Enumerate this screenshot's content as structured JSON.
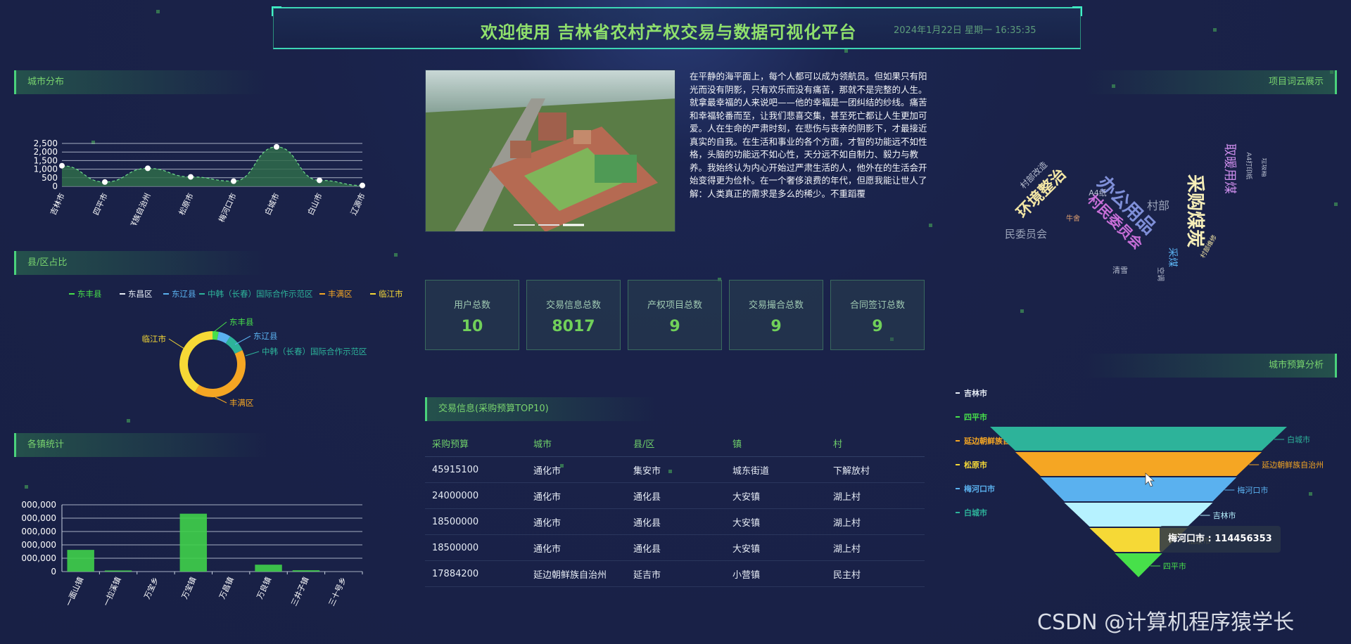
{
  "header": {
    "title": "欢迎使用 吉林省农村产权交易与数据可视化平台",
    "datetime": "2024年1月22日 星期一 16:35:35"
  },
  "panels": {
    "city_distribution": "城市分布",
    "county_share": "县/区占比",
    "town_stats": "各镇统计",
    "word_cloud": "项目词云展示",
    "city_budget": "城市预算分析",
    "trade_info": "交易信息(采购预算TOP10)"
  },
  "article": "在平静的海平面上，每个人都可以成为领航员。但如果只有阳光而没有阴影，只有欢乐而没有痛苦，那就不是完整的人生。就拿最幸福的人来说吧——他的幸福是一团纠结的纱线。痛苦和幸福轮番而至，让我们悲喜交集，甚至死亡都让人生更加可爱。人在生命的严肃时刻，在悲伤与丧亲的阴影下，才最接近真实的自我。在生活和事业的各个方面，才智的功能远不如性格，头脑的功能远不如心性，天分远不如自制力、毅力与教养。我始终认为内心开始过严肃生活的人，他外在的生活会开始变得更为俭朴。在一个奢侈浪费的年代，但愿我能让世人了解：人类真正的需求是多么的稀少。不重蹈覆",
  "stats": [
    {
      "label": "用户总数",
      "value": "10"
    },
    {
      "label": "交易信息总数",
      "value": "8017"
    },
    {
      "label": "产权项目总数",
      "value": "9"
    },
    {
      "label": "交易撮合总数",
      "value": "9"
    },
    {
      "label": "合同签订总数",
      "value": "9"
    }
  ],
  "table": {
    "headers": [
      "采购预算",
      "城市",
      "县/区",
      "镇",
      "村"
    ],
    "rows": [
      [
        "45915100",
        "通化市",
        "集安市",
        "城东街道",
        "下解放村"
      ],
      [
        "24000000",
        "通化市",
        "通化县",
        "大安镇",
        "湖上村"
      ],
      [
        "18500000",
        "通化市",
        "通化县",
        "大安镇",
        "湖上村"
      ],
      [
        "18500000",
        "通化市",
        "通化县",
        "大安镇",
        "湖上村"
      ],
      [
        "17884200",
        "延边朝鲜族自治州",
        "延吉市",
        "小营镇",
        "民主村"
      ]
    ]
  },
  "tooltip": "梅河口市 : 114456353",
  "watermark": "CSDN @计算机程序猿学长",
  "colors": {
    "accent_green": "#71d05a",
    "title_green": "#8fe06c",
    "area_fill": "#2f6b4a",
    "funnel": [
      "#2db39a",
      "#f5a623",
      "#5ab1ef",
      "#b6f2ff",
      "#f6d936",
      "#47e04a"
    ]
  },
  "word_cloud": [
    {
      "text": "采购煤炭",
      "color": "#f6eeb8",
      "size": 26,
      "rotate": 90
    },
    {
      "text": "办公用品",
      "color": "#7f8fd8",
      "size": 26,
      "rotate": 45
    },
    {
      "text": "环境整治",
      "color": "#f3e6a4",
      "size": 22,
      "rotate": -45
    },
    {
      "text": "村民委员会",
      "color": "#c86fd8",
      "size": 20,
      "rotate": 45
    },
    {
      "text": "取暖用煤",
      "color": "#c98be8",
      "size": 18,
      "rotate": 90
    },
    {
      "text": "村部",
      "color": "#9aa3b8",
      "size": 16,
      "rotate": 0
    },
    {
      "text": "民委员会",
      "color": "#9aa3b8",
      "size": 15,
      "rotate": 0
    },
    {
      "text": "采煤",
      "color": "#5ab1ef",
      "size": 14,
      "rotate": 90
    },
    {
      "text": "村部改造",
      "color": "#b8bfd0",
      "size": 12,
      "rotate": -45
    },
    {
      "text": "A4纸",
      "color": "#b8bfd0",
      "size": 11,
      "rotate": 0
    },
    {
      "text": "牛舍",
      "color": "#e0a070",
      "size": 10,
      "rotate": 0
    },
    {
      "text": "清雪",
      "color": "#b8bfd0",
      "size": 11,
      "rotate": 0
    },
    {
      "text": "空调",
      "color": "#b8bfd0",
      "size": 10,
      "rotate": 90
    },
    {
      "text": "村部维修",
      "color": "#f3e6a4",
      "size": 9,
      "rotate": -60
    },
    {
      "text": "A4打印纸",
      "color": "#b8bfd0",
      "size": 9,
      "rotate": 90
    },
    {
      "text": "垃圾箱",
      "color": "#b8bfd0",
      "size": 9,
      "rotate": 90
    }
  ],
  "chart_data": [
    {
      "type": "area",
      "title": "城市分布",
      "categories": [
        "吉林市",
        "四平市",
        "延边朝鲜族自治州",
        "松原市",
        "梅河口市",
        "白城市",
        "白山市",
        "辽源市"
      ],
      "values": [
        1200,
        250,
        1050,
        550,
        300,
        2300,
        350,
        50
      ],
      "ylim": [
        0,
        2500
      ],
      "yticks": [
        "2,500",
        "2,000",
        "1,500",
        "1,000",
        "500",
        "0"
      ]
    },
    {
      "type": "pie",
      "title": "县/区占比",
      "legend": [
        "东丰县",
        "东昌区",
        "东辽县",
        "中韩（长春）国际合作示范区",
        "丰满区",
        "临江市"
      ],
      "legend_colors": [
        "#47e04a",
        "#e6ecf5",
        "#5ab1ef",
        "#2db39a",
        "#f5a623",
        "#f6d936"
      ],
      "labels": [
        "东丰县",
        "东辽县",
        "中韩（长春）国际合作示范区",
        "丰满区",
        "临江市"
      ],
      "values": [
        3,
        6,
        9,
        41,
        41
      ]
    },
    {
      "type": "bar",
      "title": "各镇统计",
      "categories": [
        "一面山镇",
        "一拉溪镇",
        "万宝乡",
        "万宝镇",
        "万昌镇",
        "万良镇",
        "三井子镇",
        "三十号乡"
      ],
      "values": [
        1950000,
        100000,
        0,
        5200000,
        0,
        620000,
        120000,
        0
      ],
      "yticks": [
        "000,000",
        "000,000",
        "000,000",
        "000,000",
        "000,000",
        "0"
      ],
      "ylim": [
        0,
        6000000
      ]
    },
    {
      "type": "funnel",
      "title": "城市预算分析",
      "legend": [
        "吉林市",
        "四平市",
        "延边朝鲜族自治州",
        "松原市",
        "梅河口市",
        "白城市"
      ],
      "legend_colors": [
        "#e6ecf5",
        "#47e04a",
        "#f5a623",
        "#f6d936",
        "#5ab1ef",
        "#2db39a"
      ],
      "layers": [
        {
          "name": "白城市",
          "color": "#2db39a",
          "value": 100
        },
        {
          "name": "延边朝鲜族自治州",
          "color": "#f5a623",
          "value": 83
        },
        {
          "name": "梅河口市",
          "color": "#5ab1ef",
          "value": 66,
          "tooltip_value": 114456353
        },
        {
          "name": "吉林市",
          "color": "#b6f2ff",
          "value": 50
        },
        {
          "name": "松原市",
          "color": "#f6d936",
          "value": 33
        },
        {
          "name": "四平市",
          "color": "#47e04a",
          "value": 16
        }
      ]
    }
  ]
}
